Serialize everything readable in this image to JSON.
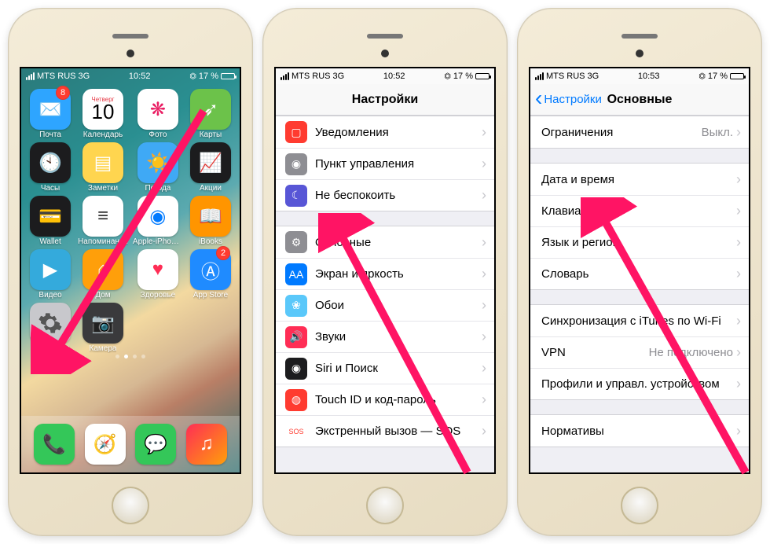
{
  "status": {
    "carrier": "MTS RUS",
    "net": "3G",
    "battery_pct": "17 %",
    "rotor": "⏣"
  },
  "times": {
    "p1": "10:52",
    "p2": "10:52",
    "p3": "10:53"
  },
  "phone1": {
    "cal": {
      "dow": "Четверг",
      "num": "10"
    },
    "apps": [
      {
        "name": "Почта",
        "emoji": "✉️",
        "bg": "#2ea5ff",
        "badge": "8"
      },
      {
        "name": "Календарь",
        "cal": true
      },
      {
        "name": "Фото",
        "emoji": "❋",
        "bg": "#fff",
        "fg": "#e91e63"
      },
      {
        "name": "Карты",
        "emoji": "➶",
        "bg": "#6cc24a"
      },
      {
        "name": "Часы",
        "emoji": "🕙",
        "bg": "#1c1c1e"
      },
      {
        "name": "Заметки",
        "emoji": "▤",
        "bg": "#ffd54f"
      },
      {
        "name": "Погода",
        "emoji": "☀️",
        "bg": "#3fa9f5"
      },
      {
        "name": "Акции",
        "emoji": "📈",
        "bg": "#1c1c1e"
      },
      {
        "name": "Wallet",
        "emoji": "💳",
        "bg": "#1c1c1e"
      },
      {
        "name": "Напоминания",
        "emoji": "≡",
        "bg": "#fff",
        "fg": "#333"
      },
      {
        "name": "Apple-iPhon…",
        "emoji": "◉",
        "bg": "#fff",
        "fg": "#007aff"
      },
      {
        "name": "iBooks",
        "emoji": "📖",
        "bg": "#ff9500"
      },
      {
        "name": "Видео",
        "emoji": "▶︎",
        "bg": "#34aadc"
      },
      {
        "name": "Дом",
        "emoji": "⌂",
        "bg": "#ff9f0a"
      },
      {
        "name": "Здоровье",
        "emoji": "♥",
        "bg": "#fff",
        "fg": "#ff2d55"
      },
      {
        "name": "App Store",
        "emoji": "Ⓐ",
        "bg": "#1f8bff",
        "badge": "2"
      },
      {
        "name": "Настройки",
        "gear": true,
        "bg": "#c8c8cc"
      },
      {
        "name": "Камера",
        "emoji": "📷",
        "bg": "#3a3a3c"
      }
    ],
    "dock": [
      {
        "name": "Телефон",
        "emoji": "📞",
        "bg": "#34c759"
      },
      {
        "name": "Safari",
        "emoji": "🧭",
        "bg": "#fff"
      },
      {
        "name": "Сообщения",
        "emoji": "💬",
        "bg": "#34c759"
      },
      {
        "name": "Музыка",
        "emoji": "♫",
        "bg": "linear-gradient(135deg,#ff2d55,#ff9f0a)"
      }
    ]
  },
  "phone2": {
    "title": "Настройки",
    "groups": [
      [
        {
          "label": "Уведомления",
          "ic": "▢",
          "bg": "#ff3b30"
        },
        {
          "label": "Пункт управления",
          "ic": "◉",
          "bg": "#8e8e93"
        },
        {
          "label": "Не беспокоить",
          "ic": "☾",
          "bg": "#5856d6"
        }
      ],
      [
        {
          "label": "Основные",
          "ic": "⚙",
          "bg": "#8e8e93"
        },
        {
          "label": "Экран и яркость",
          "ic": "AA",
          "bg": "#007aff"
        },
        {
          "label": "Обои",
          "ic": "❀",
          "bg": "#5ac8fa"
        },
        {
          "label": "Звуки",
          "ic": "🔊",
          "bg": "#ff2d55"
        },
        {
          "label": "Siri и Поиск",
          "ic": "◉",
          "bg": "#1c1c1e"
        },
        {
          "label": "Touch ID и код-пароль",
          "ic": "◍",
          "bg": "#ff3b30"
        },
        {
          "label": "Экстренный вызов — SOS",
          "ic": "SOS",
          "bg": "#fff",
          "fg": "#ff3b30"
        }
      ]
    ]
  },
  "phone3": {
    "back": "Настройки",
    "title": "Основные",
    "groups": [
      [
        {
          "label": "Ограничения",
          "value": "Выкл."
        }
      ],
      [
        {
          "label": "Дата и время"
        },
        {
          "label": "Клавиатура"
        },
        {
          "label": "Язык и регион"
        },
        {
          "label": "Словарь"
        }
      ],
      [
        {
          "label": "Синхронизация с iTunes по Wi-Fi"
        },
        {
          "label": "VPN",
          "value": "Не подключено"
        },
        {
          "label": "Профили и управл. устройством"
        }
      ],
      [
        {
          "label": "Нормативы"
        }
      ]
    ]
  }
}
